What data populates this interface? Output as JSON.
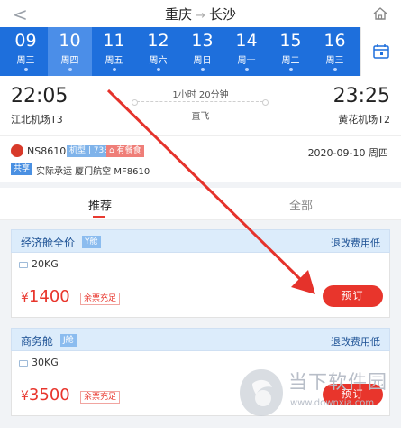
{
  "header": {
    "from": "重庆",
    "separator": "→",
    "to": "长沙"
  },
  "dates": [
    {
      "day": "09",
      "weekday": "周三",
      "selected": false
    },
    {
      "day": "10",
      "weekday": "周四",
      "selected": true
    },
    {
      "day": "11",
      "weekday": "周五",
      "selected": false
    },
    {
      "day": "12",
      "weekday": "周六",
      "selected": false
    },
    {
      "day": "13",
      "weekday": "周日",
      "selected": false
    },
    {
      "day": "14",
      "weekday": "周一",
      "selected": false
    },
    {
      "day": "15",
      "weekday": "周二",
      "selected": false
    },
    {
      "day": "16",
      "weekday": "周三",
      "selected": false
    }
  ],
  "flight": {
    "dep_time": "22:05",
    "dep_airport": "江北机场T3",
    "arr_time": "23:25",
    "arr_airport": "黄花机场T2",
    "duration": "1小时 20分钟",
    "direct": "直飞",
    "flight_no": "NS8610",
    "model_tag": "机型 | 738",
    "meal_tag": "有餐食",
    "date": "2020-09-10 周四",
    "share_tag": "共享",
    "share_text": "实际承运 厦门航空 MF8610"
  },
  "tabs": {
    "recommended": "推荐",
    "all": "全部"
  },
  "cabins": [
    {
      "name": "经济舱全价",
      "class": "Y舱",
      "rule": "退改费用低",
      "baggage": "20KG",
      "currency": "¥",
      "price": "1400",
      "stock": "余票充足",
      "book": "预订"
    },
    {
      "name": "商务舱",
      "class": "J舱",
      "rule": "退改费用低",
      "baggage": "30KG",
      "currency": "¥",
      "price": "3500",
      "stock": "余票充足",
      "book": "预订"
    }
  ],
  "watermark": {
    "name": "当下软件园",
    "url": "www.downxia.com"
  },
  "colors": {
    "primary": "#1e6fdc",
    "accent": "#e8352c",
    "annotation": "#e5322b"
  }
}
